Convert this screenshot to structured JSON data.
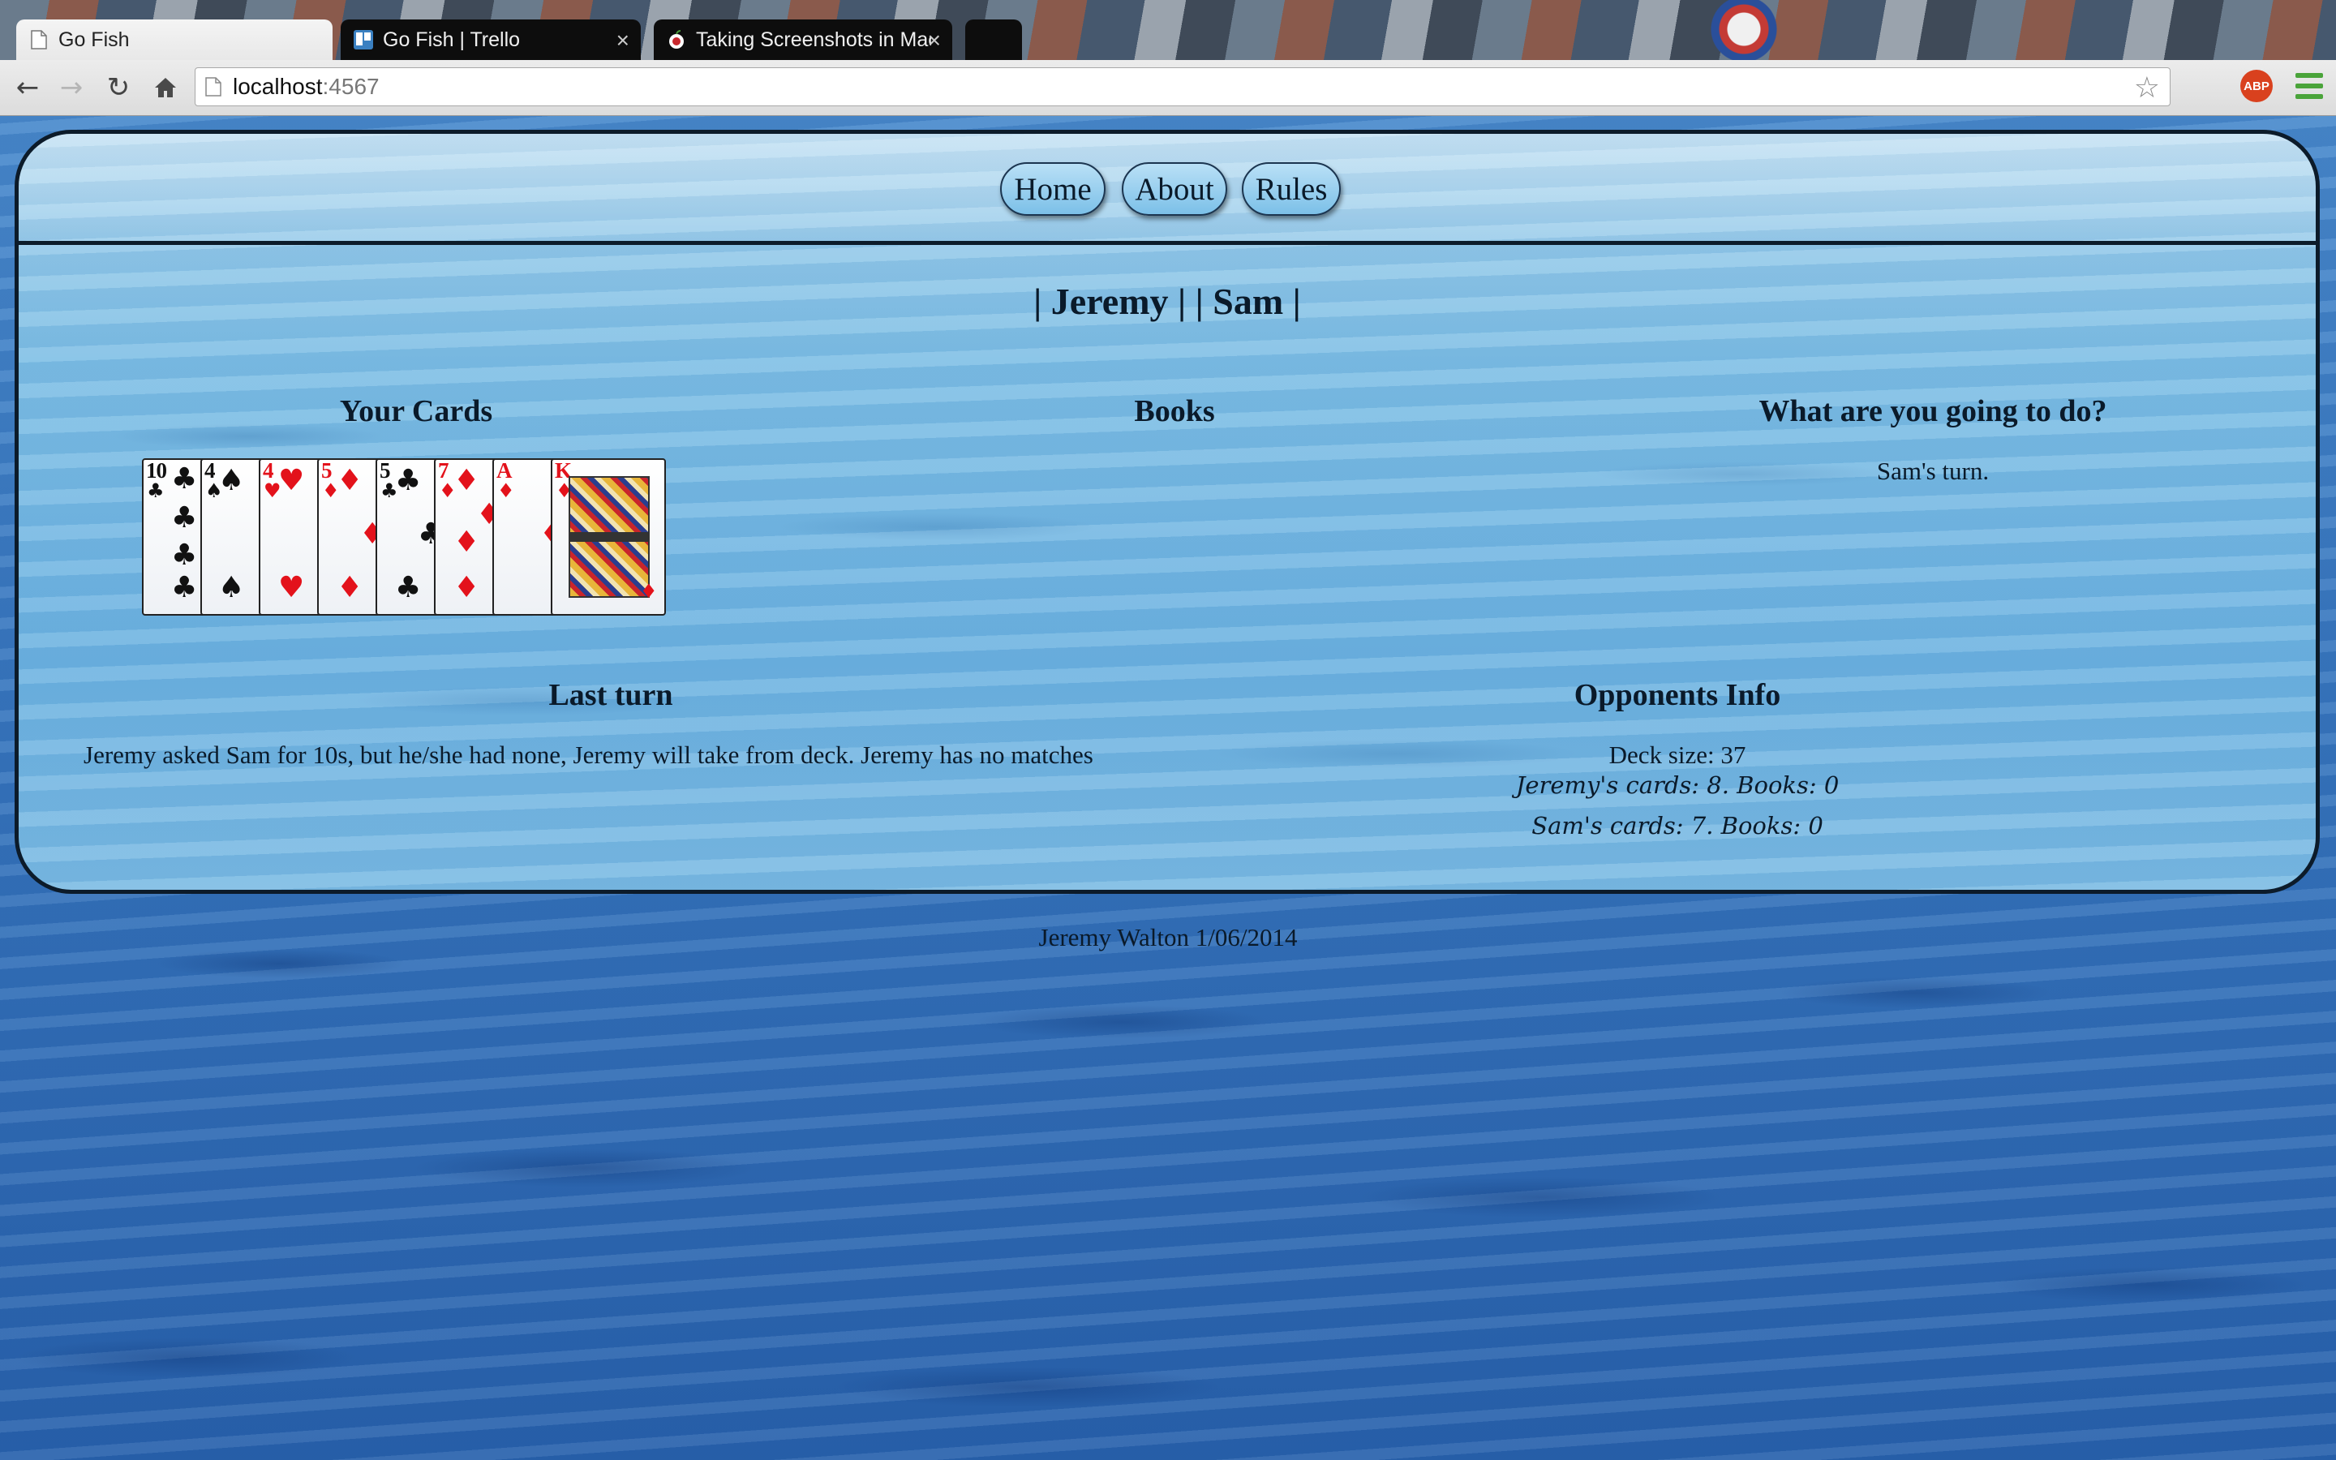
{
  "browser": {
    "tabs": [
      {
        "title": "Go Fish",
        "active": true
      },
      {
        "title": "Go Fish | Trello",
        "active": false
      },
      {
        "title": "Taking Screenshots in Mac",
        "active": false
      }
    ],
    "address": {
      "host": "localhost",
      "port": ":4567"
    },
    "abp_label": "ABP"
  },
  "nav": {
    "home": "Home",
    "about": "About",
    "rules": "Rules"
  },
  "game": {
    "players_line": "| Jeremy | | Sam |",
    "your_cards_title": "Your Cards",
    "books_title": "Books",
    "action_title": "What are you going to do?",
    "action_status": "Sam's turn.",
    "last_turn_title": "Last turn",
    "last_turn_text": "Jeremy asked Sam for 10s, but he/she had none, Jeremy will take from deck. Jeremy has no matches",
    "opponents_title": "Opponents Info",
    "deck_size": "Deck size: 37",
    "opponents": [
      "Jeremy's cards: 8. Books: 0",
      "Sam's cards: 7. Books: 0"
    ],
    "hand": [
      {
        "rank": "10",
        "suit": "♣",
        "color": "#111111"
      },
      {
        "rank": "4",
        "suit": "♠",
        "color": "#111111"
      },
      {
        "rank": "4",
        "suit": "♥",
        "color": "#e3121b"
      },
      {
        "rank": "5",
        "suit": "♦",
        "color": "#e3121b"
      },
      {
        "rank": "5",
        "suit": "♣",
        "color": "#111111"
      },
      {
        "rank": "7",
        "suit": "♦",
        "color": "#e3121b"
      },
      {
        "rank": "A",
        "suit": "♦",
        "color": "#e3121b"
      },
      {
        "rank": "K",
        "suit": "♦",
        "color": "#e3121b"
      }
    ]
  },
  "footer": "Jeremy Walton 1/06/2014"
}
